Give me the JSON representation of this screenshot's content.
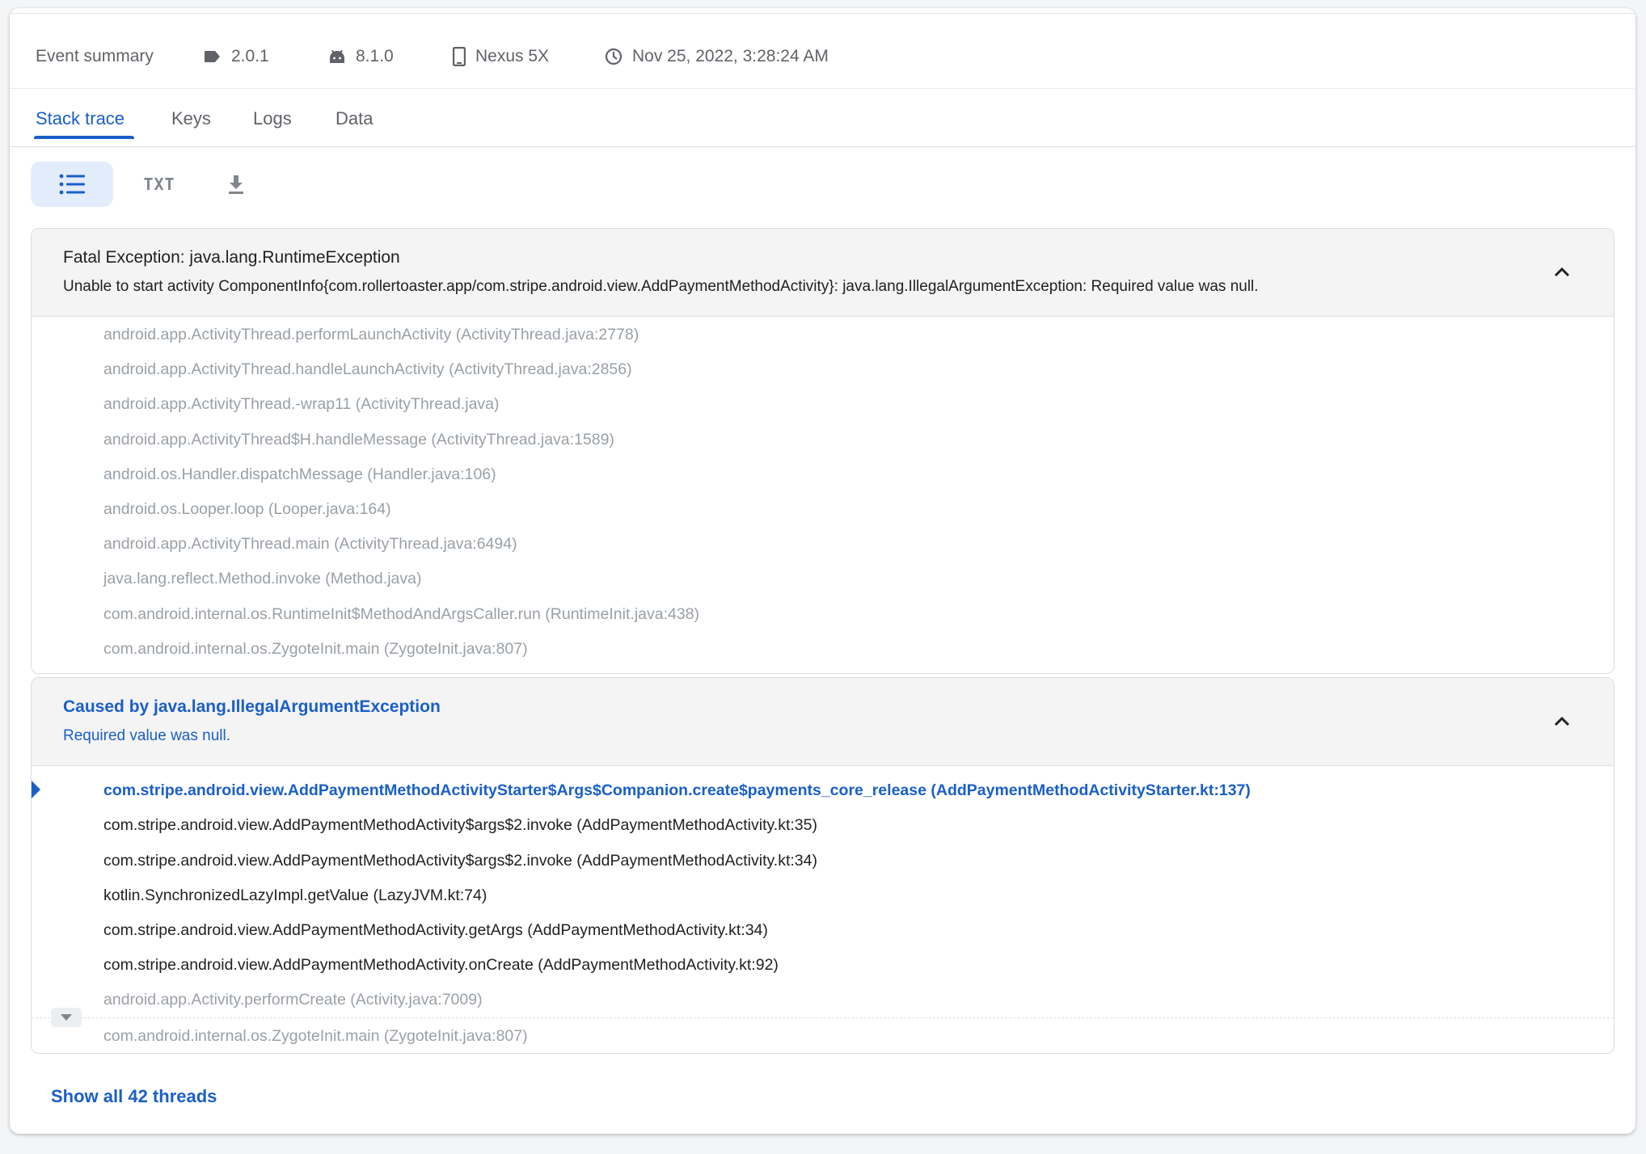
{
  "summary": {
    "title": "Event summary",
    "version": "2.0.1",
    "android": "8.1.0",
    "device": "Nexus 5X",
    "timestamp": "Nov 25, 2022, 3:28:24 AM"
  },
  "tabs": [
    "Stack trace",
    "Keys",
    "Logs",
    "Data"
  ],
  "active_tab": "Stack trace",
  "view": {
    "list_icon": "list-icon",
    "txt_label": "TXT",
    "download_icon": "download-icon"
  },
  "exception1": {
    "title": "Fatal Exception: java.lang.RuntimeException",
    "message": "Unable to start activity ComponentInfo{com.rollertoaster.app/com.stripe.android.view.AddPaymentMethodActivity}: java.lang.IllegalArgumentException: Required value was null.",
    "frames": [
      "android.app.ActivityThread.performLaunchActivity (ActivityThread.java:2778)",
      "android.app.ActivityThread.handleLaunchActivity (ActivityThread.java:2856)",
      "android.app.ActivityThread.-wrap11 (ActivityThread.java)",
      "android.app.ActivityThread$H.handleMessage (ActivityThread.java:1589)",
      "android.os.Handler.dispatchMessage (Handler.java:106)",
      "android.os.Looper.loop (Looper.java:164)",
      "android.app.ActivityThread.main (ActivityThread.java:6494)",
      "java.lang.reflect.Method.invoke (Method.java)",
      "com.android.internal.os.RuntimeInit$MethodAndArgsCaller.run (RuntimeInit.java:438)",
      "com.android.internal.os.ZygoteInit.main (ZygoteInit.java:807)"
    ]
  },
  "exception2": {
    "title": "Caused by java.lang.IllegalArgumentException",
    "message": "Required value was null.",
    "frames": [
      "com.stripe.android.view.AddPaymentMethodActivityStarter$Args$Companion.create$payments_core_release (AddPaymentMethodActivityStarter.kt:137)",
      "com.stripe.android.view.AddPaymentMethodActivity$args$2.invoke (AddPaymentMethodActivity.kt:35)",
      "com.stripe.android.view.AddPaymentMethodActivity$args$2.invoke (AddPaymentMethodActivity.kt:34)",
      "kotlin.SynchronizedLazyImpl.getValue (LazyJVM.kt:74)",
      "com.stripe.android.view.AddPaymentMethodActivity.getArgs (AddPaymentMethodActivity.kt:34)",
      "com.stripe.android.view.AddPaymentMethodActivity.onCreate (AddPaymentMethodActivity.kt:92)",
      "android.app.Activity.performCreate (Activity.java:7009)",
      "com.android.internal.os.ZygoteInit.main (ZygoteInit.java:807)"
    ]
  },
  "show_all": "Show all 42 threads",
  "colors": {
    "accent": "#1a5fc8",
    "dim_text": "#9aa0a6",
    "dark_text": "#202124"
  }
}
